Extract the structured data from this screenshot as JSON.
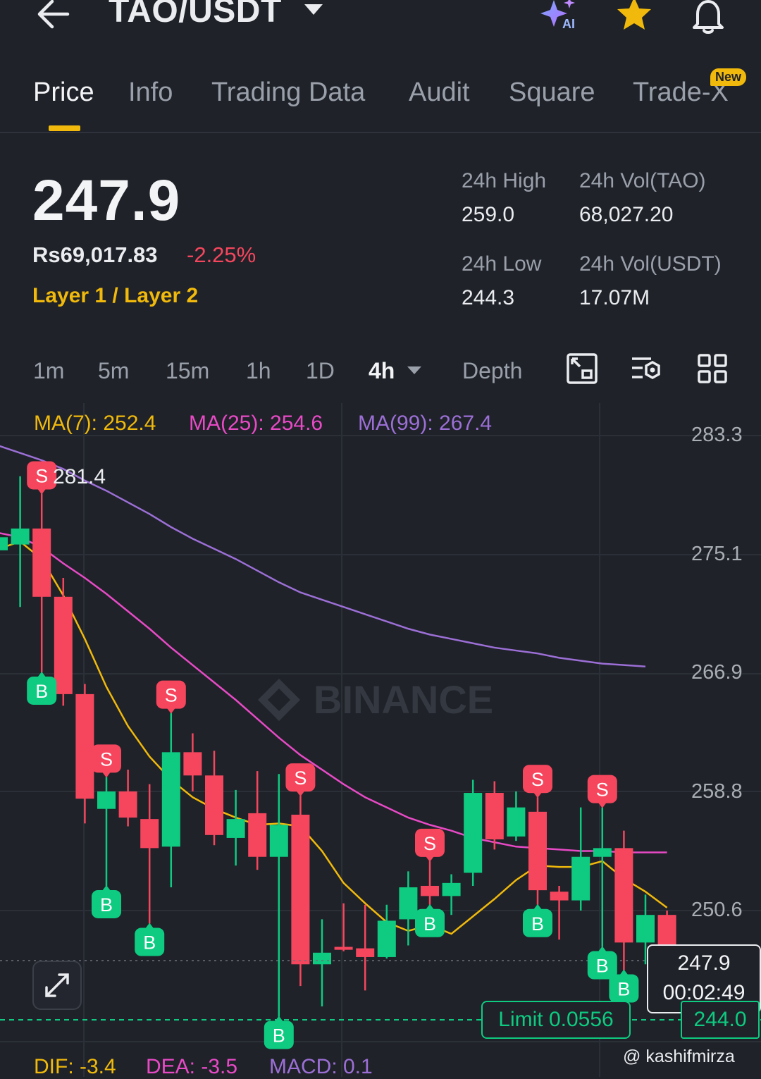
{
  "header": {
    "pair": "TAO/USDT",
    "icons": [
      "arrow-left-icon",
      "caret-down-icon",
      "ai-sparkle-icon",
      "star-icon",
      "bell-icon"
    ],
    "ai_label": "AI"
  },
  "tabs": [
    {
      "label": "Price",
      "active": true
    },
    {
      "label": "Info"
    },
    {
      "label": "Trading Data"
    },
    {
      "label": "Audit"
    },
    {
      "label": "Square"
    },
    {
      "label": "Trade-X",
      "badge": "New"
    }
  ],
  "price": {
    "last": "247.9",
    "inr": "Rs69,017.83",
    "change": "-2.25%",
    "tag": "Layer 1 / Layer 2"
  },
  "stats": {
    "high_label": "24h High",
    "high": "259.0",
    "vol_tao_label": "24h Vol(TAO)",
    "vol_tao": "68,027.20",
    "low_label": "24h Low",
    "low": "244.3",
    "vol_usdt_label": "24h Vol(USDT)",
    "vol_usdt": "17.07M"
  },
  "intervals": [
    "1m",
    "5m",
    "15m",
    "1h",
    "1D",
    "4h",
    "Depth"
  ],
  "active_interval": "4h",
  "chart": {
    "ma7": "MA(7): 252.4",
    "ma25": "MA(25): 254.6",
    "ma99": "MA(99): 267.4",
    "axis": [
      "283.3",
      "275.1",
      "266.9",
      "258.8",
      "250.6"
    ],
    "high_marker": "281.4",
    "current_price": "247.9",
    "countdown": "00:02:49",
    "limit_label": "Limit 0.0556",
    "limit_price": "244.0",
    "watermark": "BINANCE",
    "colors": {
      "up": "#0ecb81",
      "down": "#f6465d",
      "ma7": "#f0b90b",
      "ma25": "#e84ac6",
      "ma99": "#9c6fd6"
    }
  },
  "chart_data": {
    "type": "candlestick",
    "ylim": [
      241.0,
      285.0
    ],
    "yticks": [
      283.3,
      275.1,
      266.9,
      258.8,
      250.6
    ],
    "candles": [
      {
        "o": 275.4,
        "h": 277.0,
        "l": 273.9,
        "c": 276.3
      },
      {
        "o": 275.8,
        "h": 280.5,
        "l": 271.5,
        "c": 276.9
      },
      {
        "o": 276.9,
        "h": 279.3,
        "l": 267.0,
        "c": 272.2
      },
      {
        "o": 272.2,
        "h": 273.5,
        "l": 264.7,
        "c": 265.5
      },
      {
        "o": 265.5,
        "h": 266.2,
        "l": 256.6,
        "c": 258.3
      },
      {
        "o": 257.6,
        "h": 259.8,
        "l": 252.3,
        "c": 258.8
      },
      {
        "o": 258.8,
        "h": 260.3,
        "l": 256.4,
        "c": 257.0
      },
      {
        "o": 256.9,
        "h": 259.3,
        "l": 249.7,
        "c": 254.9
      },
      {
        "o": 255.0,
        "h": 264.2,
        "l": 252.2,
        "c": 261.5
      },
      {
        "o": 261.5,
        "h": 262.8,
        "l": 258.8,
        "c": 259.9
      },
      {
        "o": 259.9,
        "h": 261.6,
        "l": 255.1,
        "c": 255.8
      },
      {
        "o": 255.6,
        "h": 258.9,
        "l": 253.7,
        "c": 256.9
      },
      {
        "o": 257.3,
        "h": 260.2,
        "l": 253.4,
        "c": 254.3
      },
      {
        "o": 254.3,
        "h": 260.0,
        "l": 243.3,
        "c": 256.5
      },
      {
        "o": 257.2,
        "h": 258.5,
        "l": 245.4,
        "c": 246.9
      },
      {
        "o": 246.9,
        "h": 250.0,
        "l": 244.0,
        "c": 247.7
      },
      {
        "o": 248.1,
        "h": 251.1,
        "l": 247.8,
        "c": 247.9
      },
      {
        "o": 248.0,
        "h": 251.0,
        "l": 245.1,
        "c": 247.4
      },
      {
        "o": 247.4,
        "h": 251.0,
        "l": 247.3,
        "c": 249.9
      },
      {
        "o": 250.0,
        "h": 253.3,
        "l": 248.2,
        "c": 252.2
      },
      {
        "o": 252.3,
        "h": 254.0,
        "l": 251.0,
        "c": 251.6
      },
      {
        "o": 251.6,
        "h": 253.1,
        "l": 250.3,
        "c": 252.5
      },
      {
        "o": 253.2,
        "h": 259.6,
        "l": 252.3,
        "c": 258.7
      },
      {
        "o": 258.7,
        "h": 259.5,
        "l": 254.8,
        "c": 255.5
      },
      {
        "o": 255.7,
        "h": 258.8,
        "l": 255.4,
        "c": 257.7
      },
      {
        "o": 257.4,
        "h": 258.4,
        "l": 251.0,
        "c": 252.0
      },
      {
        "o": 251.9,
        "h": 252.3,
        "l": 248.6,
        "c": 251.3
      },
      {
        "o": 251.3,
        "h": 257.7,
        "l": 250.6,
        "c": 254.3
      },
      {
        "o": 254.3,
        "h": 257.7,
        "l": 248.1,
        "c": 254.9
      },
      {
        "o": 254.9,
        "h": 256.1,
        "l": 246.5,
        "c": 248.4
      },
      {
        "o": 248.4,
        "h": 251.7,
        "l": 246.9,
        "c": 250.3
      },
      {
        "o": 250.3,
        "h": 250.6,
        "l": 246.5,
        "c": 247.9
      }
    ],
    "ma7": [
      275.5,
      276.0,
      274.8,
      272.3,
      269.3,
      266.0,
      263.3,
      261.2,
      259.6,
      258.4,
      257.6,
      257.0,
      256.5,
      256.6,
      256.4,
      254.7,
      252.5,
      251.1,
      249.8,
      249.2,
      249.6,
      249.0,
      250.2,
      251.4,
      252.7,
      253.7,
      253.6,
      253.6,
      254.0,
      252.8,
      251.9,
      250.8
    ],
    "ma25": [
      276.6,
      276.3,
      275.6,
      274.5,
      273.5,
      272.4,
      271.2,
      270.0,
      268.7,
      267.5,
      266.3,
      265.1,
      263.8,
      262.5,
      261.3,
      260.3,
      259.3,
      258.4,
      257.7,
      257.0,
      256.5,
      256.1,
      255.6,
      255.3,
      255.0,
      254.9,
      254.8,
      254.7,
      254.7,
      254.6,
      254.6,
      254.6
    ],
    "ma99": [
      282.6,
      282.1,
      281.6,
      281.0,
      280.2,
      279.5,
      278.7,
      277.9,
      277.0,
      276.2,
      275.5,
      274.8,
      274.0,
      273.2,
      272.5,
      272.0,
      271.5,
      271.0,
      270.5,
      270.0,
      269.6,
      269.3,
      269.0,
      268.7,
      268.5,
      268.3,
      268.0,
      267.8,
      267.6,
      267.5,
      267.4
    ],
    "signals": [
      {
        "i": 2,
        "t": "S"
      },
      {
        "i": 2,
        "t": "B"
      },
      {
        "i": 5,
        "t": "S"
      },
      {
        "i": 5,
        "t": "B"
      },
      {
        "i": 7,
        "t": "B"
      },
      {
        "i": 8,
        "t": "S"
      },
      {
        "i": 14,
        "t": "S"
      },
      {
        "i": 13,
        "t": "B"
      },
      {
        "i": 20,
        "t": "S"
      },
      {
        "i": 20,
        "t": "B"
      },
      {
        "i": 25,
        "t": "S"
      },
      {
        "i": 25,
        "t": "B"
      },
      {
        "i": 28,
        "t": "S"
      },
      {
        "i": 28,
        "t": "B"
      },
      {
        "i": 29,
        "t": "B"
      },
      {
        "i": 31,
        "t": "B"
      }
    ],
    "indicators": {
      "dif": "DIF: -3.4",
      "dea": "DEA: -3.5",
      "macd": "MACD: 0.1"
    }
  },
  "footer": {
    "handle": "@ kashifmirza"
  }
}
